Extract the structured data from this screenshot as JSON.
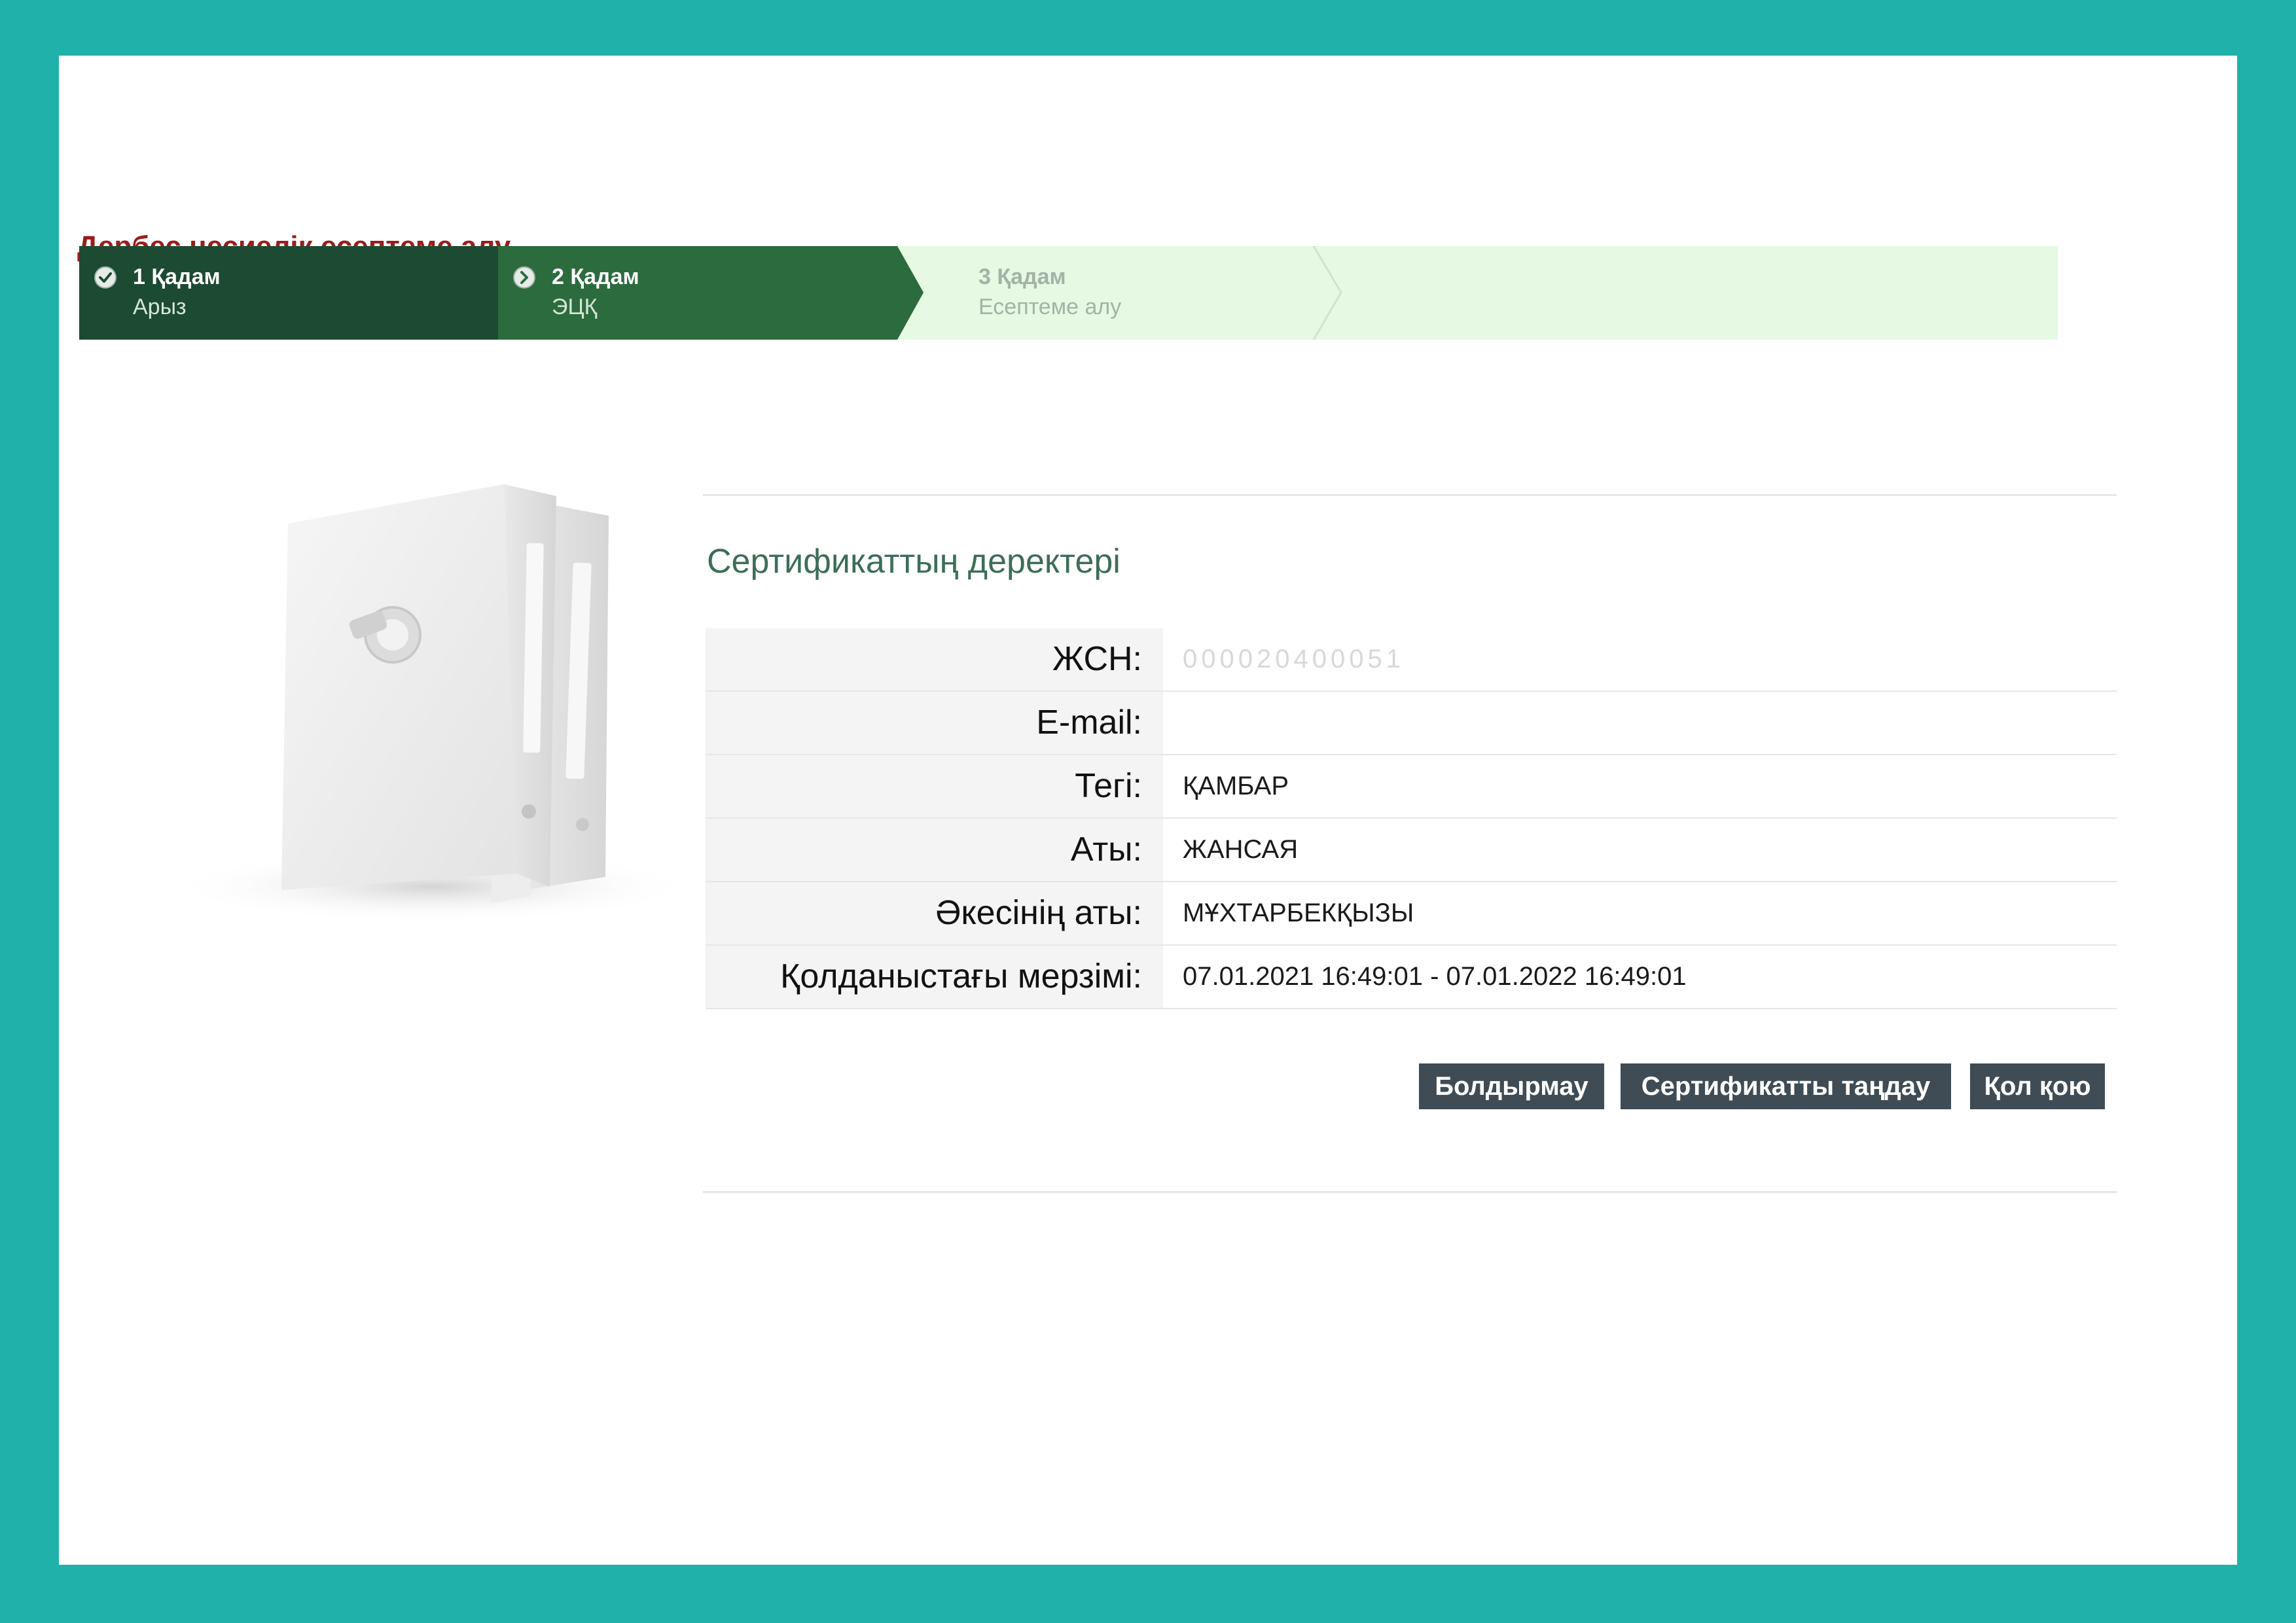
{
  "page": {
    "title": "Дербес несиелік есептеме алу"
  },
  "stepper": {
    "steps": [
      {
        "number": "1 Қадам",
        "label": "Арыз",
        "state": "done",
        "icon": "check-icon"
      },
      {
        "number": "2 Қадам",
        "label": "ЭЦҚ",
        "state": "active",
        "icon": "arrow-right-icon"
      },
      {
        "number": "3 Қадам",
        "label": "Есептеме алу",
        "state": "pending"
      }
    ]
  },
  "certificate": {
    "title": "Сертификаттың деректері",
    "rows": [
      {
        "label": "ЖСН:",
        "value": "000020400051"
      },
      {
        "label": "E-mail:",
        "value": ""
      },
      {
        "label": "Тегі:",
        "value": "ҚАМБАР"
      },
      {
        "label": "Аты:",
        "value": "ЖАНСАЯ"
      },
      {
        "label": "Әкесінің аты:",
        "value": "МҰХТАРБЕКҚЫЗЫ"
      },
      {
        "label": "Қолданыстағы мерзімі:",
        "value": "07.01.2021 16:49:01 - 07.01.2022 16:49:01"
      }
    ]
  },
  "actions": {
    "cancel_label": "Болдырмау",
    "select_label": "Сертификатты таңдау",
    "sign_label": "Қол қою"
  },
  "colors": {
    "frame": "#20b2aa",
    "title": "#9b1c1c",
    "step_done": "#1d4a33",
    "step_active": "#2c6b3d",
    "step_pending": "#e5f9e3",
    "button": "#3f4c55"
  }
}
